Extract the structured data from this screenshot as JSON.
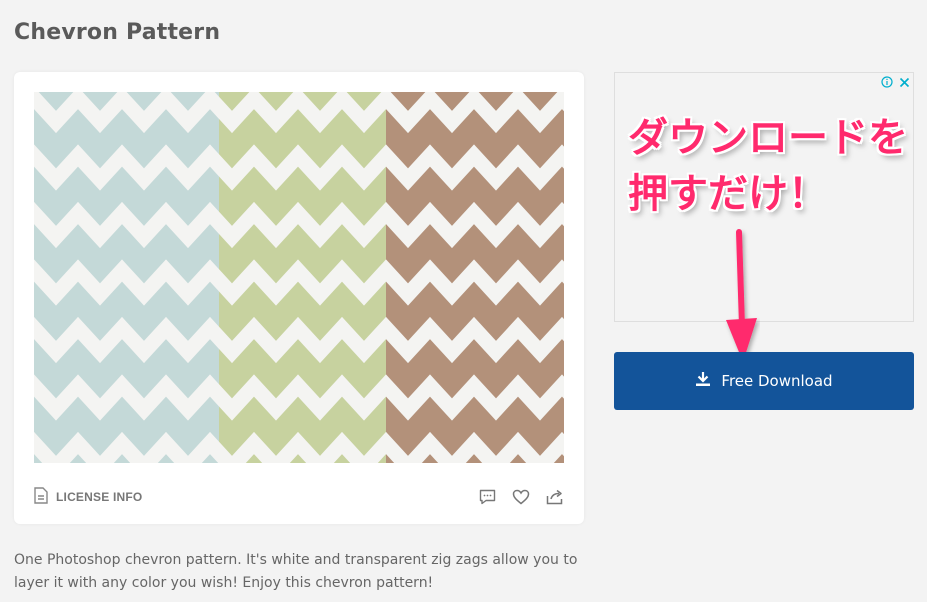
{
  "page": {
    "title": "Chevron Pattern"
  },
  "card": {
    "license_label": "LICENSE INFO",
    "icons": [
      "document-icon",
      "comment-icon",
      "heart-icon",
      "share-icon"
    ],
    "pattern_colors": [
      "#c4d9d8",
      "#c7d29f",
      "#b3917a"
    ]
  },
  "description": "One Photoshop chevron pattern. It's white and transparent zig zags allow you to layer it with any color you wish! Enjoy this chevron pattern!",
  "ad": {
    "annotation_line1": "ダウンロードを",
    "annotation_line2": "押すだけ！",
    "icons": [
      "info-icon",
      "close-icon"
    ]
  },
  "download": {
    "label": "Free Download",
    "icon": "download-icon",
    "color": "#13549a"
  },
  "colors": {
    "accent": "#ff2a6d",
    "background": "#f3f3f3"
  }
}
